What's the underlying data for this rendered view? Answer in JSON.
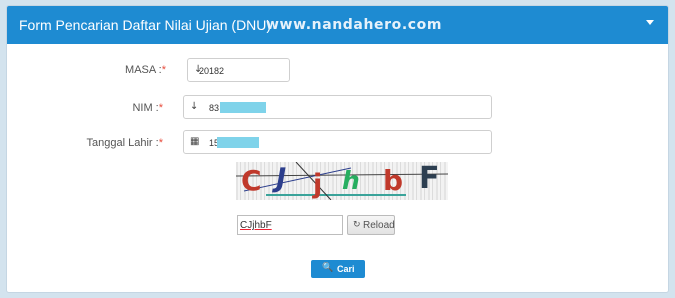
{
  "header": {
    "title": "Form Pencarian Daftar Nilai Ujian (DNU)",
    "watermark": "www.nandahero.com",
    "collapse_icon": "caret-down-icon"
  },
  "form": {
    "masa": {
      "label": "MASA :",
      "required_mark": "*",
      "icon": "sort-numeric-icon",
      "icon_glyph": "↓",
      "value": "20182"
    },
    "nim": {
      "label": "NIM :",
      "required_mark": "*",
      "icon": "sort-numeric-icon",
      "icon_glyph": "↓",
      "value": "83"
    },
    "tanggal_lahir": {
      "label": "Tanggal Lahir :",
      "required_mark": "*",
      "icon": "calendar-icon",
      "icon_glyph": "▦",
      "value": "15"
    }
  },
  "captcha": {
    "chars": [
      "C",
      "J",
      "j",
      "h",
      "b",
      "F"
    ],
    "colors": [
      "#c0392b",
      "#2c3e8c",
      "#c0392b",
      "#27ae60",
      "#c0392b",
      "#2c3e50"
    ],
    "input_value": "CJjhbF",
    "reload_label": "Reload",
    "reload_icon": "refresh-icon"
  },
  "submit": {
    "label": "Cari",
    "icon": "search-icon"
  },
  "colors": {
    "accent": "#1e8bd2",
    "required": "#e74c3c",
    "mask": "#7fd3ea"
  }
}
